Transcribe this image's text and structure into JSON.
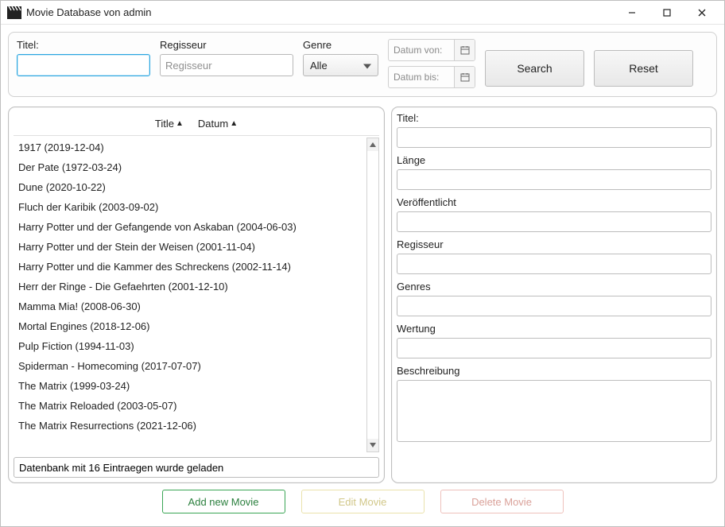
{
  "window": {
    "title": "Movie Database von admin"
  },
  "filter": {
    "title": {
      "label": "Titel:",
      "value": ""
    },
    "director": {
      "label": "Regisseur",
      "placeholder": "Regisseur",
      "value": ""
    },
    "genre": {
      "label": "Genre",
      "selected": "Alle"
    },
    "date_from_placeholder": "Datum von:",
    "date_to_placeholder": "Datum bis:",
    "search_label": "Search",
    "reset_label": "Reset"
  },
  "list": {
    "header_title": "Title",
    "header_date": "Datum",
    "items": [
      "1917 (2019-12-04)",
      "Der Pate (1972-03-24)",
      "Dune (2020-10-22)",
      "Fluch der Karibik (2003-09-02)",
      "Harry Potter und der Gefangende von Askaban (2004-06-03)",
      "Harry Potter und der Stein der Weisen (2001-11-04)",
      "Harry Potter und die Kammer des Schreckens (2002-11-14)",
      "Herr der Ringe - Die Gefaehrten (2001-12-10)",
      "Mamma Mia! (2008-06-30)",
      "Mortal Engines (2018-12-06)",
      "Pulp Fiction (1994-11-03)",
      "Spiderman - Homecoming (2017-07-07)",
      "The Matrix (1999-03-24)",
      "The Matrix Reloaded (2003-05-07)",
      "The Matrix Resurrections (2021-12-06)"
    ],
    "status": "Datenbank mit 16 Eintraegen wurde geladen"
  },
  "details": {
    "title_label": "Titel:",
    "length_label": "Länge",
    "published_label": "Veröffentlicht",
    "director_label": "Regisseur",
    "genres_label": "Genres",
    "rating_label": "Wertung",
    "description_label": "Beschreibung"
  },
  "actions": {
    "add": "Add new Movie",
    "edit": "Edit Movie",
    "delete": "Delete Movie"
  }
}
